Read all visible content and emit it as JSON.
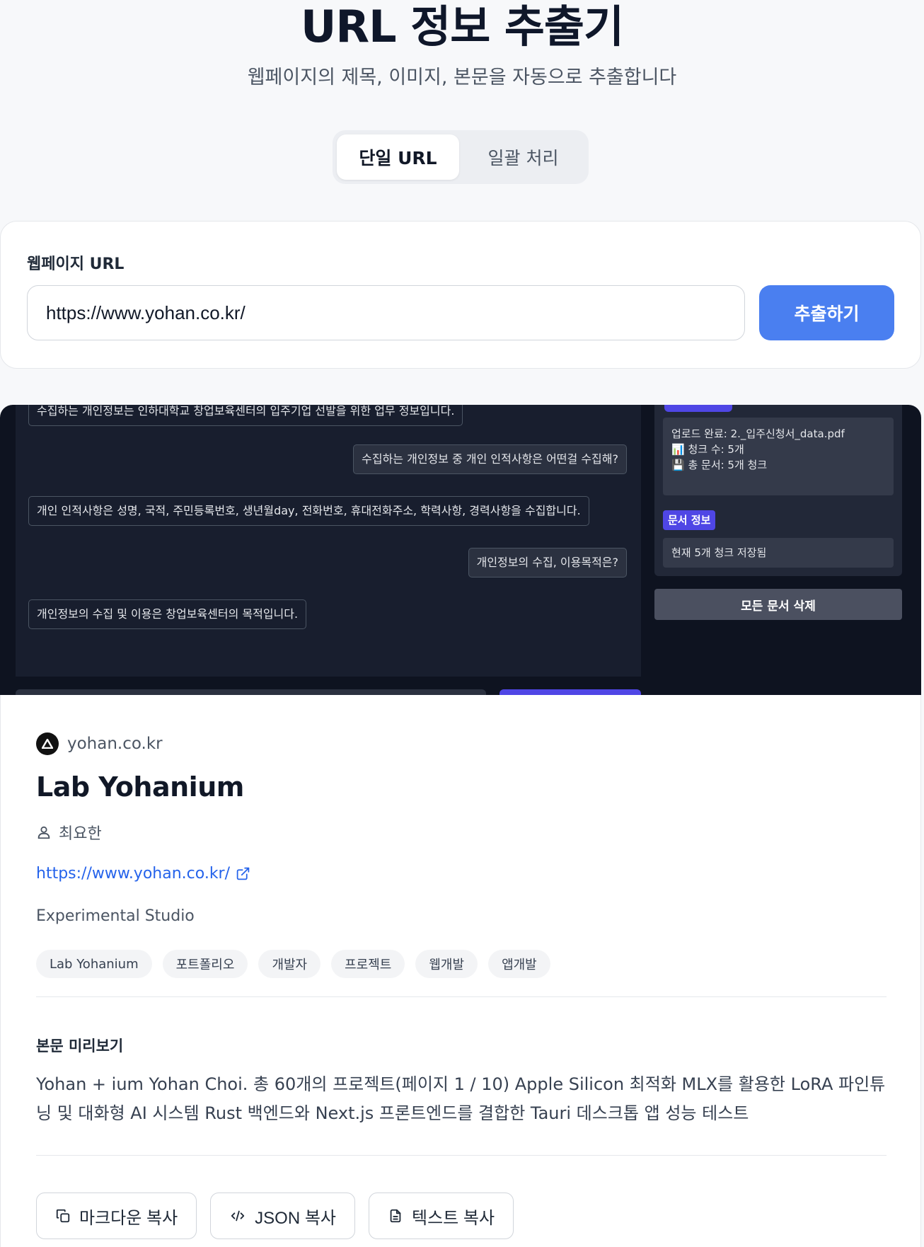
{
  "header": {
    "title": "URL 정보 추출기",
    "subtitle": "웹페이지의 제목, 이미지, 본문을 자동으로 추출합니다"
  },
  "tabs": [
    {
      "label": "단일 URL",
      "active": true
    },
    {
      "label": "일괄 처리",
      "active": false
    }
  ],
  "url_form": {
    "label": "웹페이지 URL",
    "value": "https://www.yohan.co.kr/",
    "submit_label": "추출하기"
  },
  "preview_image": {
    "chat": [
      {
        "role": "bot",
        "text": "수집하는 개인정보는 인하대학교 창업보육센터의 입주기업 선발을 위한 업무 정보입니다."
      },
      {
        "role": "user",
        "text": "수집하는 개인정보 중 개인 인적사항은 어떤걸 수집해?"
      },
      {
        "role": "bot",
        "text": "개인 인적사항은 성명, 국적, 주민등록번호, 생년월day, 전화번호, 휴대전화주소, 학력사항, 경력사항을 수집합니다."
      },
      {
        "role": "user",
        "text": "개인정보의 수집, 이용목적은?"
      },
      {
        "role": "bot",
        "text": "개인정보의 수집 및 이용은 창업보육센터의 목적입니다."
      }
    ],
    "upload_status": {
      "line1": "업로드 완료: 2._입주신청서_data.pdf",
      "line2": "📊 청크 수: 5개",
      "line3": "💾 총 문서: 5개 청크"
    },
    "doc_info_badge": "문서 정보",
    "doc_info_text": "현재 5개 청크 저장됨",
    "delete_all_label": "모든 문서 삭제"
  },
  "result": {
    "site_name": "yohan.co.kr",
    "title": "Lab Yohanium",
    "author": "최요한",
    "url": "https://www.yohan.co.kr/",
    "description": "Experimental Studio",
    "tags": [
      "Lab Yohanium",
      "포트폴리오",
      "개발자",
      "프로젝트",
      "웹개발",
      "앱개발"
    ],
    "preview_label": "본문 미리보기",
    "preview_text": "Yohan + ium Yohan Choi. 총 60개의 프로젝트(페이지 1 / 10) Apple Silicon 최적화 MLX를 활용한 LoRA 파인튜닝 및 대화형 AI 시스템 Rust 백엔드와 Next.js 프론트엔드를 결합한 Tauri 데스크톱 앱 성능 테스트"
  },
  "actions": {
    "copy_markdown": "마크다운 복사",
    "copy_json": "JSON 복사",
    "copy_text": "텍스트 복사"
  },
  "colors": {
    "accent": "#4a7ff0",
    "link": "#2563eb",
    "chat_bg": "#181e2e",
    "badge": "#4f46e5"
  },
  "icons": [
    "site-logo-icon",
    "user-icon",
    "external-link-icon",
    "copy-icon",
    "code-icon",
    "file-text-icon"
  ]
}
